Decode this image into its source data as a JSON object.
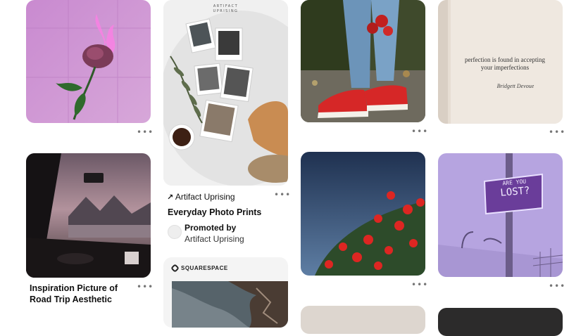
{
  "pins": {
    "rose_fire": {
      "menu": "•••"
    },
    "artifact_uprising": {
      "brand_wordmark_top": "ARTIFACT",
      "brand_wordmark_bottom": "UPRISING",
      "link_arrow": "↗",
      "source_label": "Artifact Uprising",
      "menu": "•••",
      "title": "Everyday Photo Prints",
      "promoted_by_label": "Promoted by",
      "promoter_name": "Artifact Uprising"
    },
    "red_sneakers": {
      "menu": "•••"
    },
    "book_quote": {
      "quote_line1": "perfection is found in accepting",
      "quote_line2": "your imperfections",
      "author": "Bridgett Devoue",
      "menu": "•••"
    },
    "road_trip": {
      "title": "Inspiration Picture of Road Trip Aesthetic",
      "menu": "•••"
    },
    "squarespace": {
      "brand_label": "SQUARESPACE"
    },
    "red_flowers": {
      "menu": "•••"
    },
    "are_you_lost": {
      "sign_line1": "ARE YOU",
      "sign_line2": "LOST?",
      "menu": "•••"
    }
  },
  "colors": {
    "menu_dots": "#767676",
    "title_text": "#111111"
  }
}
